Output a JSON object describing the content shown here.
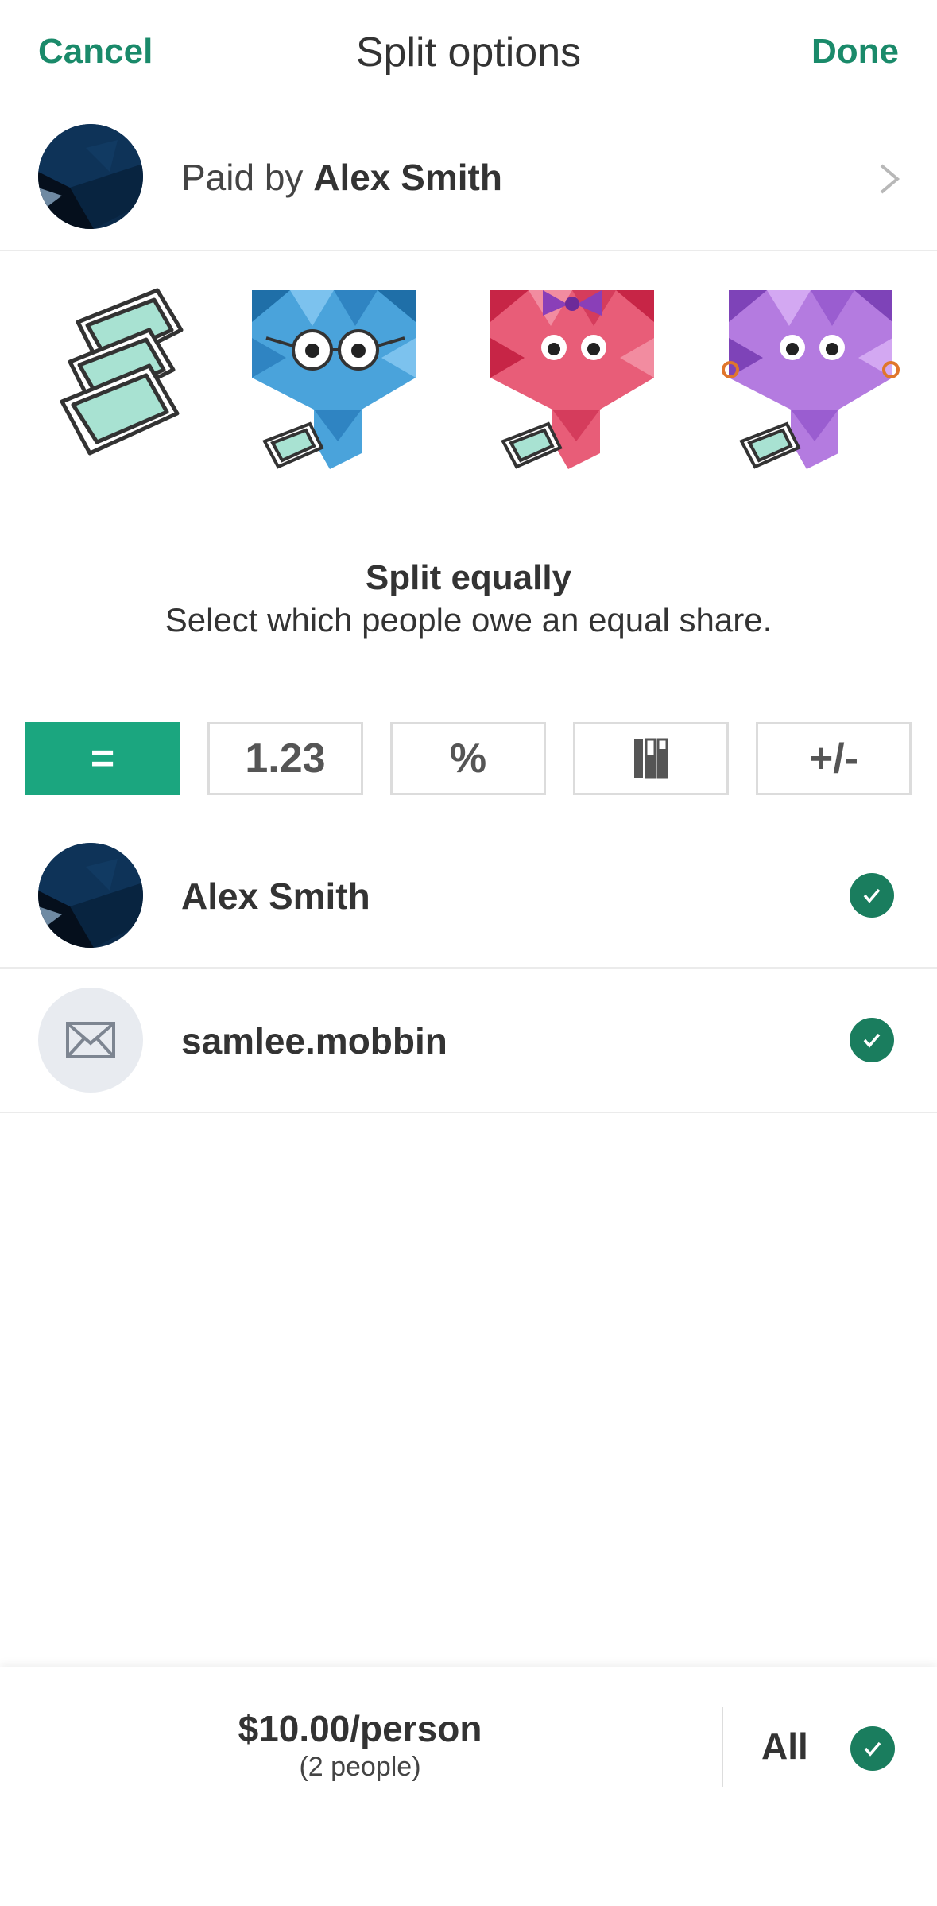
{
  "header": {
    "cancel_label": "Cancel",
    "title": "Split options",
    "done_label": "Done"
  },
  "paid_by": {
    "prefix": "Paid by",
    "payer_name": "Alex Smith"
  },
  "split_mode": {
    "title": "Split equally",
    "description": "Select which people owe an equal share."
  },
  "split_types": [
    {
      "label": "=",
      "active": true
    },
    {
      "label": "1.23",
      "active": false
    },
    {
      "label": "%",
      "active": false
    },
    {
      "label": "shares-icon",
      "active": false
    },
    {
      "label": "+/-",
      "active": false
    }
  ],
  "people": [
    {
      "name": "Alex Smith",
      "avatar": "profile-photo",
      "selected": true
    },
    {
      "name": "samlee.mobbin",
      "avatar": "envelope-icon",
      "selected": true
    }
  ],
  "footer": {
    "per_person": "$10.00/person",
    "people_count": "(2 people)",
    "all_label": "All",
    "all_selected": true
  },
  "colors": {
    "accent": "#1a8a6a",
    "active_button": "#1ba67f",
    "check": "#1a7d5e"
  }
}
